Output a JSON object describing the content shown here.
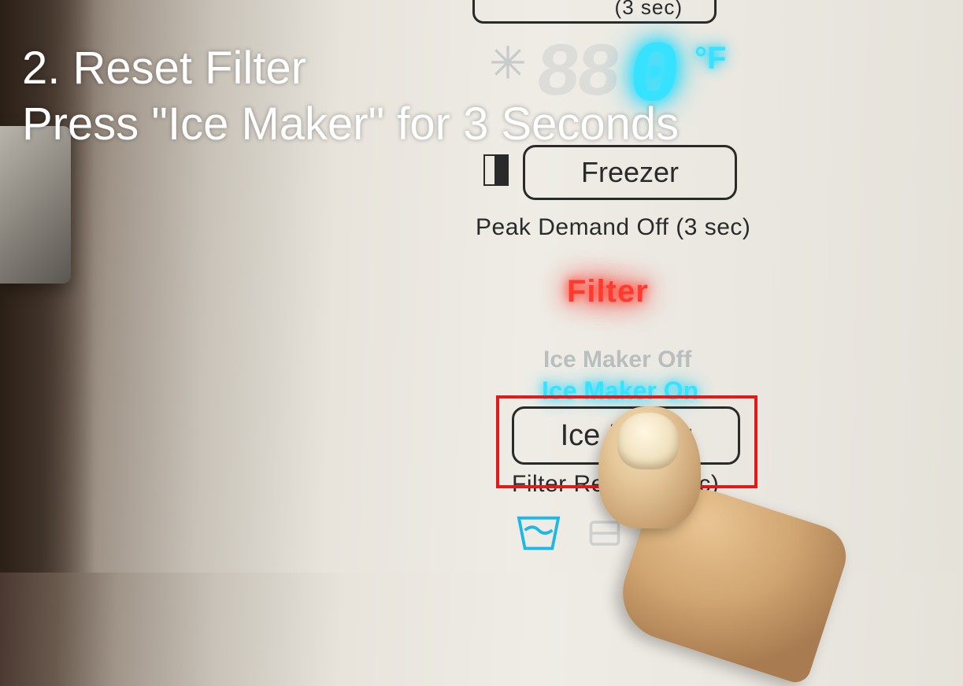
{
  "overlay": {
    "line1": "2. Reset Filter",
    "line2": "Press \"Ice Maker\" for 3 Seconds"
  },
  "display": {
    "ghost_segments": "88",
    "temperature": "0",
    "unit": "°F"
  },
  "top_partial_label": "(3 sec)",
  "freezer": {
    "button_label": "Freezer",
    "sublabel": "Peak Demand Off (3 sec)"
  },
  "filter_indicator": "Filter",
  "ice_maker": {
    "off_label": "Ice Maker Off",
    "on_label": "Ice Maker On",
    "button_label": "Ice Maker",
    "sublabel": "Filter Reset (3 sec)"
  }
}
